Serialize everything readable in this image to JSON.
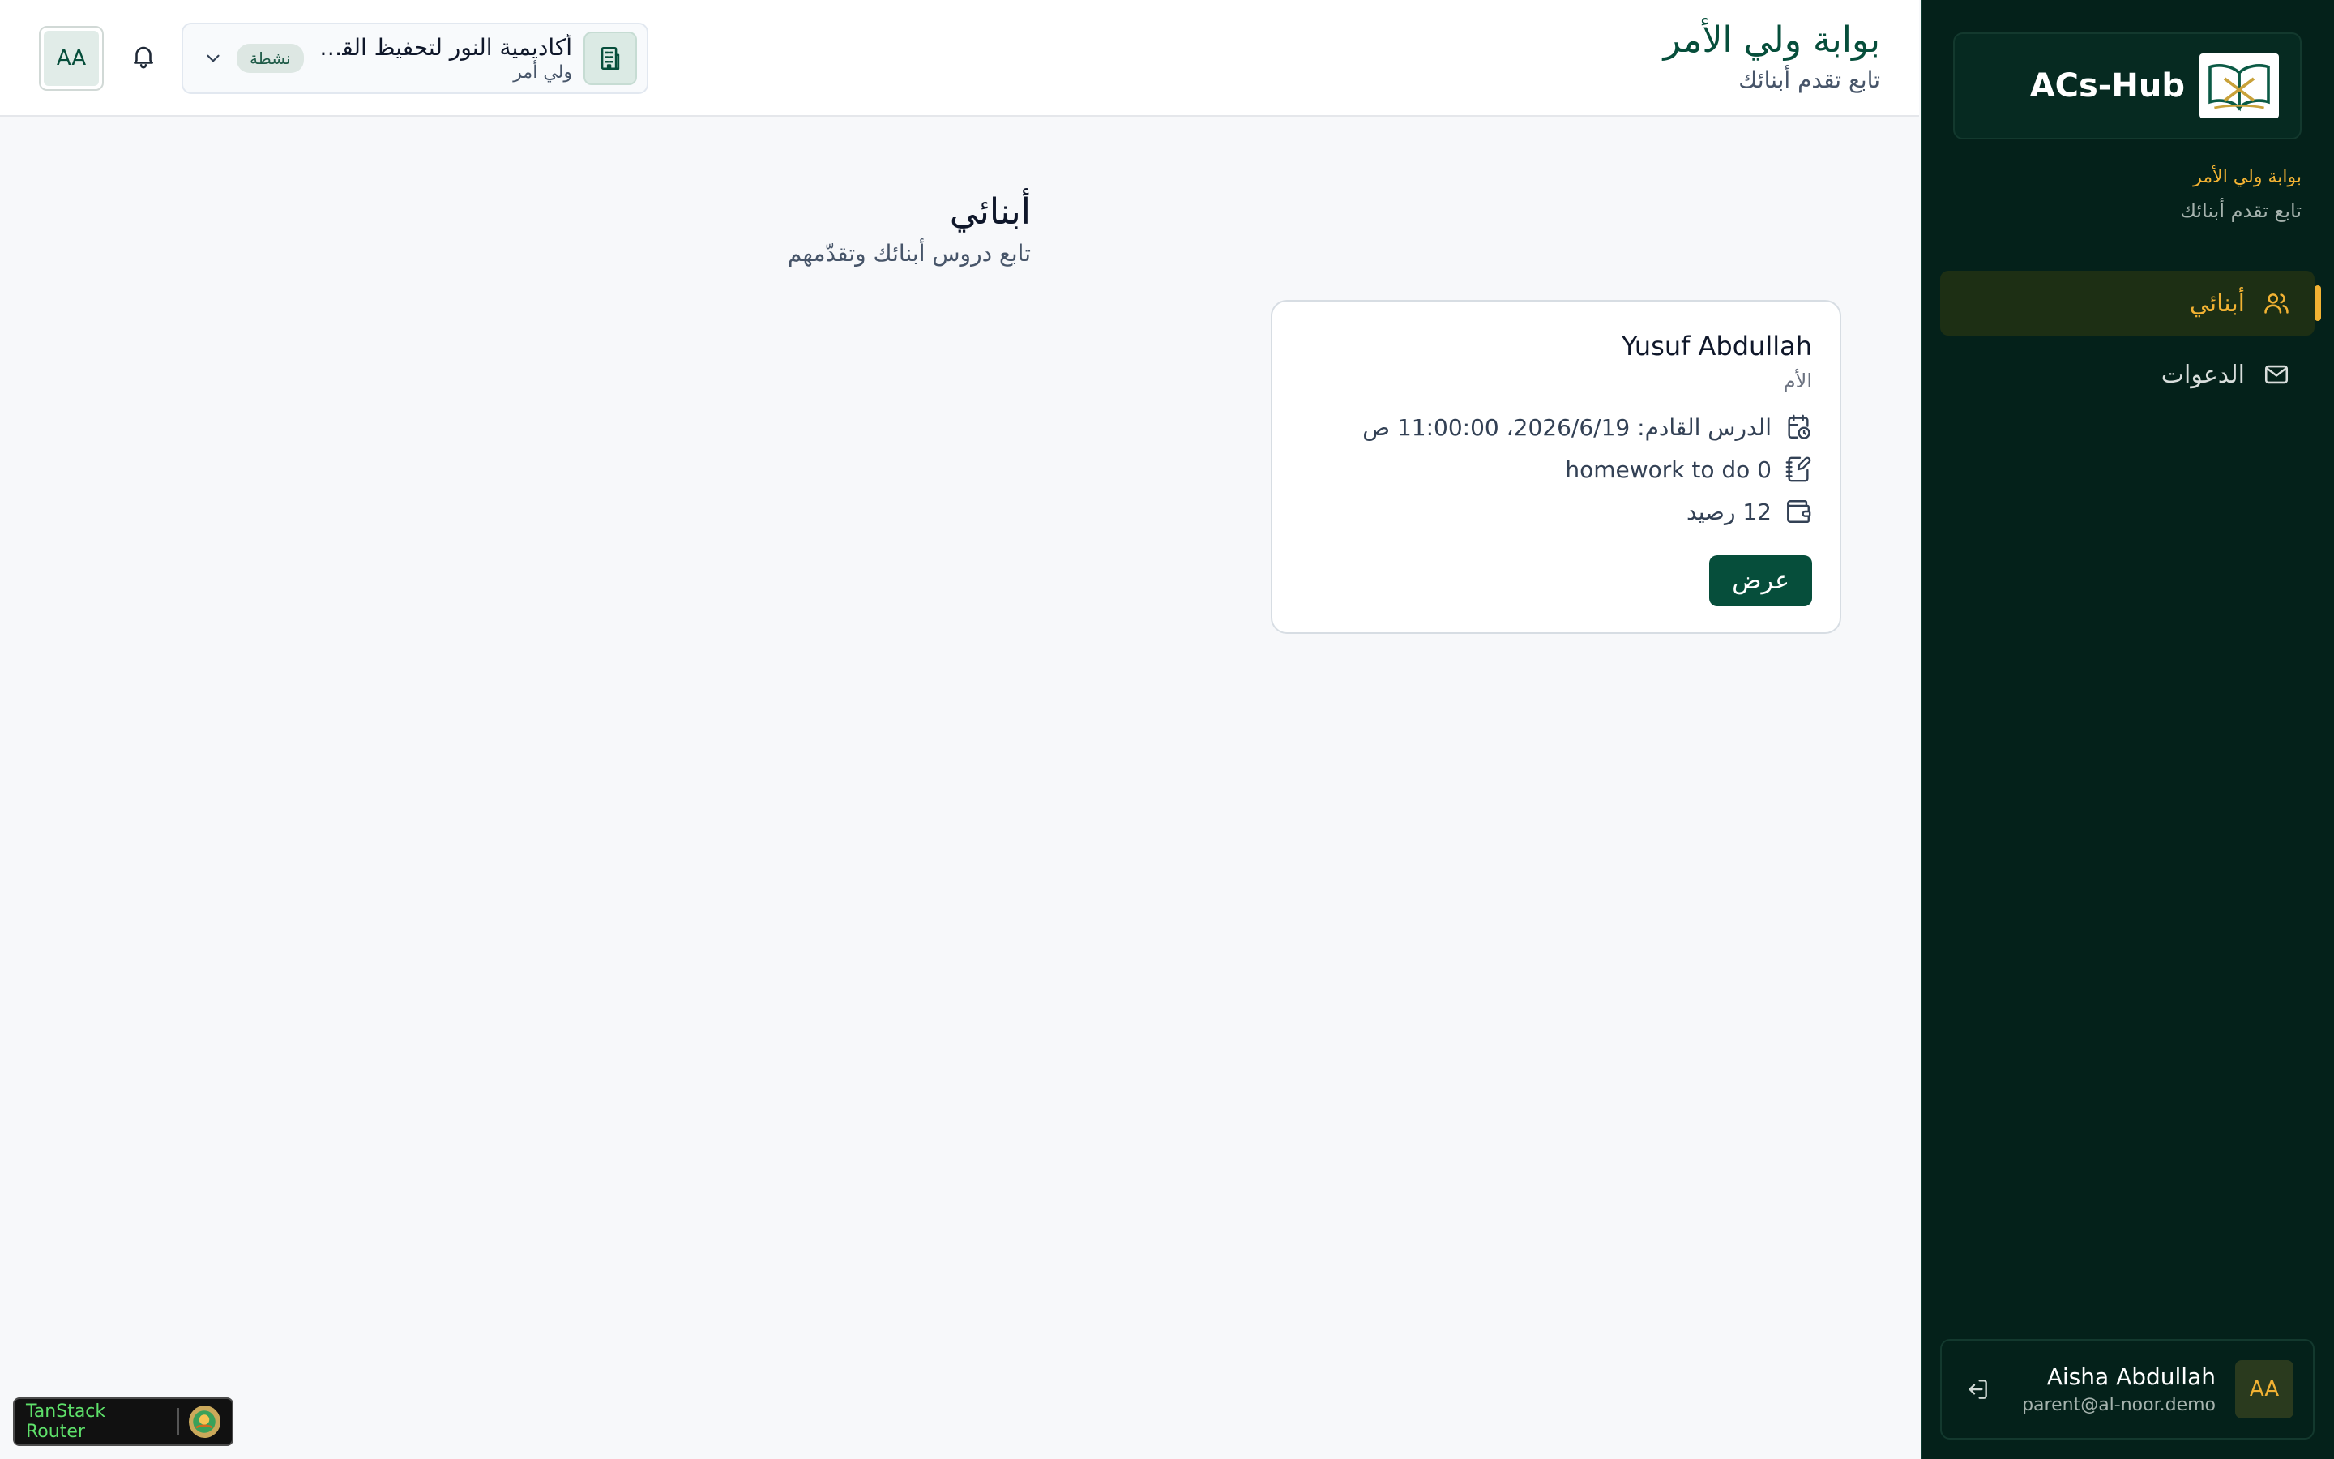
{
  "brand": {
    "name": "ACs-Hub"
  },
  "sidebar": {
    "portal_title": "بوابة ولي الأمر",
    "portal_subtitle": "تابع تقدم أبنائك",
    "items": [
      {
        "label": "أبنائي",
        "icon": "users-icon",
        "active": true
      },
      {
        "label": "الدعوات",
        "icon": "mail-icon",
        "active": false
      }
    ],
    "user": {
      "initials": "AA",
      "name": "Aisha Abdullah",
      "email": "parent@al-noor.demo"
    }
  },
  "header": {
    "title": "بوابة ولي الأمر",
    "subtitle": "تابع تقدم أبنائك",
    "org": {
      "name": "أكاديمية النور لتحفيظ القرآن",
      "role": "ولي أمر",
      "status": "نشطة"
    },
    "avatar_initials": "AA"
  },
  "main": {
    "title": "أبنائي",
    "subtitle": "تابع دروس أبنائك وتقدّمهم",
    "children": [
      {
        "name": "Yusuf Abdullah",
        "relation": "الأم",
        "next_lesson": "الدرس القادم: 2026/6/19، 11:00:00 ص",
        "homework": "homework to do 0",
        "balance": "12 رصيد",
        "view_label": "عرض"
      }
    ]
  },
  "devtools": {
    "label": "TanStack Router"
  },
  "colors": {
    "sidebar_bg": "#04211a",
    "accent": "#f2b233",
    "primary": "#064e3b"
  }
}
